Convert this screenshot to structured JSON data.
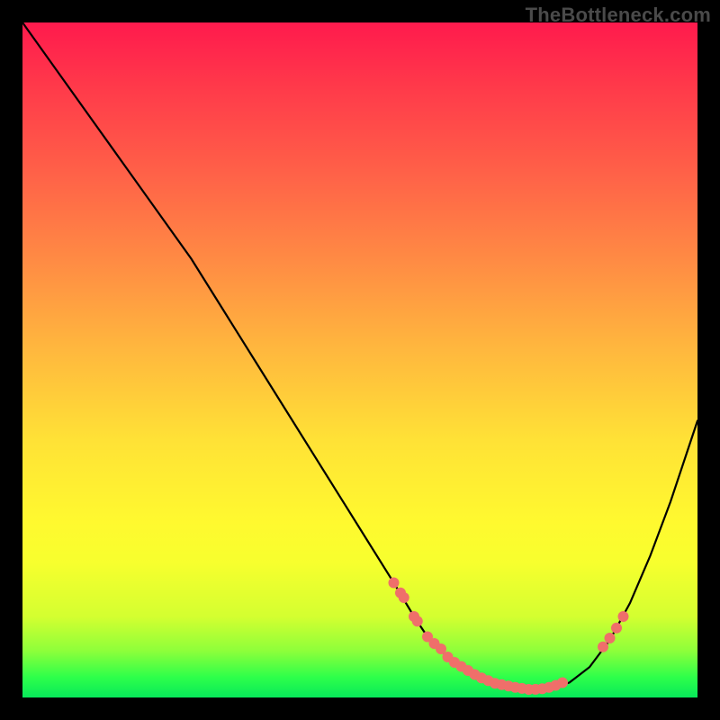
{
  "watermark": "TheBottleneck.com",
  "colors": {
    "curve": "#000000",
    "marker": "#ef6f6a",
    "frame_bg_top": "#ff1a4d",
    "frame_bg_bottom": "#07e85a"
  },
  "chart_data": {
    "type": "line",
    "title": "",
    "xlabel": "",
    "ylabel": "",
    "xlim": [
      0,
      100
    ],
    "ylim": [
      0,
      100
    ],
    "grid": false,
    "legend": false,
    "x": [
      0,
      5,
      10,
      15,
      20,
      25,
      30,
      35,
      40,
      45,
      50,
      55,
      58,
      60,
      63,
      66,
      69,
      72,
      75,
      78,
      81,
      84,
      87,
      90,
      93,
      96,
      100
    ],
    "y": [
      100,
      93,
      86,
      79,
      72,
      65,
      57,
      49,
      41,
      33,
      25,
      17,
      12,
      9,
      6,
      4,
      2.5,
      1.7,
      1.2,
      1.3,
      2.2,
      4.5,
      8.5,
      14,
      21,
      29,
      41
    ],
    "markers": {
      "x": [
        55,
        56,
        56.5,
        58,
        58.5,
        60,
        61,
        62,
        63,
        64,
        65,
        66,
        67,
        68,
        69,
        70,
        71,
        72,
        73,
        74,
        75,
        76,
        77,
        78,
        79,
        80,
        86,
        87,
        88,
        89
      ],
      "y": [
        17,
        15.5,
        14.8,
        12,
        11.3,
        9,
        8,
        7.2,
        6,
        5.2,
        4.6,
        4,
        3.4,
        2.9,
        2.5,
        2.1,
        1.9,
        1.7,
        1.5,
        1.35,
        1.2,
        1.22,
        1.3,
        1.5,
        1.8,
        2.2,
        7.5,
        8.8,
        10.3,
        12
      ]
    }
  }
}
